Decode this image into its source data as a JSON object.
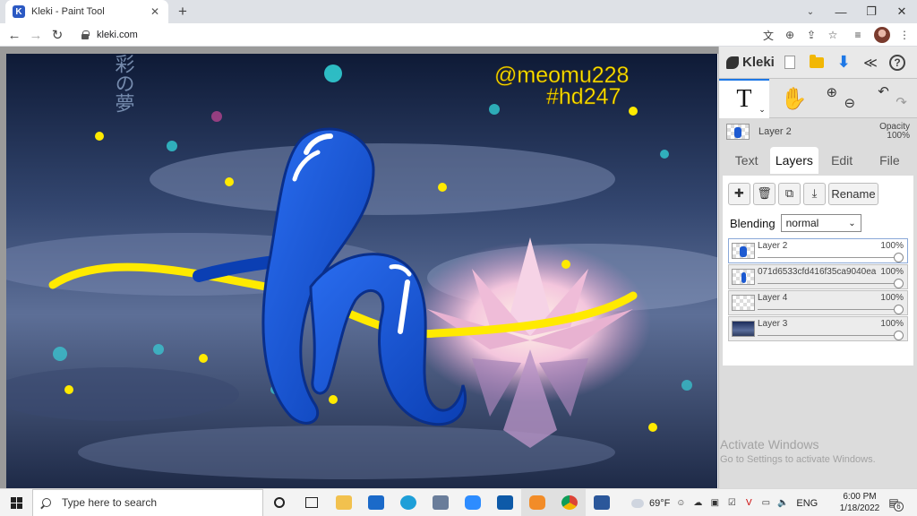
{
  "browser": {
    "tab_title": "Kleki - Paint Tool",
    "favicon_letter": "K",
    "url": "kleki.com",
    "new_tab": "+",
    "close_tab": "✕"
  },
  "canvas": {
    "watermark_1": "@meomu228",
    "watermark_2": "#hd247",
    "vertical_text": "彩の夢",
    "colors": {
      "yellow": "#ffea00",
      "blue": "#1d5ad1",
      "bg": "#1c2846"
    }
  },
  "kleki": {
    "logo": "Kleki",
    "tools": {
      "text": "T",
      "caret": "⌄"
    },
    "current_layer": {
      "name": "Layer 2",
      "opacity_label": "Opacity",
      "opacity_value": "100%"
    },
    "tabs": [
      {
        "label": "Text"
      },
      {
        "label": "Layers"
      },
      {
        "label": "Edit"
      },
      {
        "label": "File"
      }
    ],
    "active_tab": "Layers",
    "actions": {
      "rename": "Rename"
    },
    "blending": {
      "label": "Blending",
      "value": "normal"
    },
    "layers": [
      {
        "name": "Layer 2",
        "opacity": "100%"
      },
      {
        "name": "071d6533cfd416f35ca9040ea",
        "opacity": "100%"
      },
      {
        "name": "Layer 4",
        "opacity": "100%"
      },
      {
        "name": "Layer 3",
        "opacity": "100%"
      }
    ]
  },
  "windows": {
    "activate_title": "Activate Windows",
    "activate_sub": "Go to Settings to activate Windows.",
    "search_placeholder": "Type here to search",
    "weather": "69°F",
    "lang": "ENG",
    "time": "6:00 PM",
    "date": "1/18/2022",
    "notification_count": "6"
  }
}
